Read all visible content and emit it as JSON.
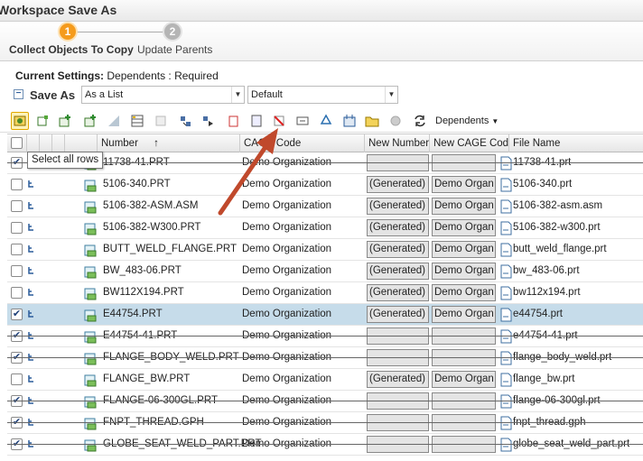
{
  "window": {
    "title": "Workspace Save As"
  },
  "wizard": {
    "steps": [
      {
        "number": "1",
        "label": "Collect Objects To Copy",
        "color": "#f59b1c"
      },
      {
        "number": "2",
        "label": "Update Parents",
        "color": "#b5b5b5"
      }
    ]
  },
  "settings": {
    "label": "Current Settings:",
    "value": "Dependents : Required"
  },
  "save_as": {
    "label": "Save As",
    "view_select": "As a List",
    "preference_select": "Default"
  },
  "toolbar": {
    "dependents_label": "Dependents",
    "icons": [
      "collect-all-icon",
      "add-objects-icon",
      "add-assembly-icon",
      "add-parts-icon",
      "table-view-icon",
      "table-list-icon",
      "refresh-icon",
      "move-forward-icon",
      "move-next-icon",
      "clear-icon",
      "layout-icon",
      "remove-icon",
      "rename-icon",
      "recycle-icon",
      "structure-icon",
      "open-folder-icon",
      "settings-icon",
      "reset-icon"
    ]
  },
  "tooltip": "Select all rows",
  "columns": {
    "number": "Number",
    "cage": "CAGE Code",
    "new_number": "New Number",
    "new_cage": "New CAGE Code",
    "file_name": "File Name"
  },
  "rows": [
    {
      "checked": true,
      "number": "11738-41.PRT",
      "org": "Demo Organization",
      "new_number": "",
      "new_cage": "",
      "file": "11738-41.prt",
      "strike": true
    },
    {
      "checked": false,
      "number": "5106-340.PRT",
      "org": "Demo Organization",
      "new_number": "(Generated)",
      "new_cage": "Demo Organ",
      "file": "5106-340.prt",
      "strike": false
    },
    {
      "checked": false,
      "number": "5106-382-ASM.ASM",
      "org": "Demo Organization",
      "new_number": "(Generated)",
      "new_cage": "Demo Organ",
      "file": "5106-382-asm.asm",
      "strike": false
    },
    {
      "checked": false,
      "number": "5106-382-W300.PRT",
      "org": "Demo Organization",
      "new_number": "(Generated)",
      "new_cage": "Demo Organ",
      "file": "5106-382-w300.prt",
      "strike": false
    },
    {
      "checked": false,
      "number": "BUTT_WELD_FLANGE.PRT",
      "org": "Demo Organization",
      "new_number": "(Generated)",
      "new_cage": "Demo Organ",
      "file": "butt_weld_flange.prt",
      "strike": false
    },
    {
      "checked": false,
      "number": "BW_483-06.PRT",
      "org": "Demo Organization",
      "new_number": "(Generated)",
      "new_cage": "Demo Organ",
      "file": "bw_483-06.prt",
      "strike": false
    },
    {
      "checked": false,
      "number": "BW112X194.PRT",
      "org": "Demo Organization",
      "new_number": "(Generated)",
      "new_cage": "Demo Organ",
      "file": "bw112x194.prt",
      "strike": false
    },
    {
      "checked": true,
      "number": "E44754.PRT",
      "org": "Demo Organization",
      "new_number": "(Generated)",
      "new_cage": "Demo Organ",
      "file": "e44754.prt",
      "strike": false,
      "selected": true
    },
    {
      "checked": true,
      "number": "E44754-41.PRT",
      "org": "Demo Organization",
      "new_number": "",
      "new_cage": "",
      "file": "e44754-41.prt",
      "strike": true
    },
    {
      "checked": true,
      "number": "FLANGE_BODY_WELD.PRT",
      "org": "Demo Organization",
      "new_number": "",
      "new_cage": "",
      "file": "flange_body_weld.prt",
      "strike": true
    },
    {
      "checked": false,
      "number": "FLANGE_BW.PRT",
      "org": "Demo Organization",
      "new_number": "(Generated)",
      "new_cage": "Demo Organ",
      "file": "flange_bw.prt",
      "strike": false
    },
    {
      "checked": true,
      "number": "FLANGE-06-300GL.PRT",
      "org": "Demo Organization",
      "new_number": "",
      "new_cage": "",
      "file": "flange-06-300gl.prt",
      "strike": true
    },
    {
      "checked": true,
      "number": "FNPT_THREAD.GPH",
      "org": "Demo Organization",
      "new_number": "",
      "new_cage": "",
      "file": "fnpt_thread.gph",
      "strike": true
    },
    {
      "checked": true,
      "number": "GLOBE_SEAT_WELD_PART.PRT",
      "org": "Demo Organization",
      "new_number": "",
      "new_cage": "",
      "file": "globe_seat_weld_part.prt",
      "strike": true
    }
  ],
  "colors": {
    "accent": "#f59b1c",
    "selected_row": "#c6dcea",
    "arrow": "#c0492c"
  }
}
